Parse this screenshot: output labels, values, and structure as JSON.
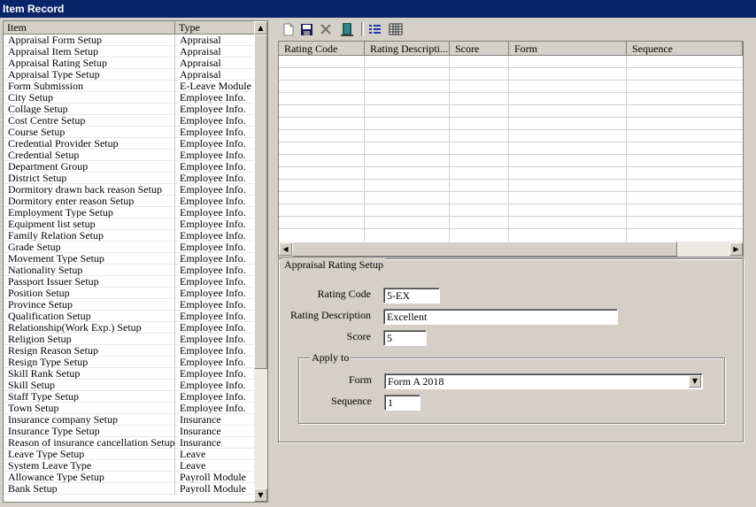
{
  "window": {
    "title": "Item Record"
  },
  "list": {
    "columns": [
      "Item",
      "Type"
    ],
    "rows": [
      [
        "Appraisal Form Setup",
        "Appraisal"
      ],
      [
        "Appraisal Item Setup",
        "Appraisal"
      ],
      [
        "Appraisal Rating Setup",
        "Appraisal"
      ],
      [
        "Appraisal Type Setup",
        "Appraisal"
      ],
      [
        "Form Submission",
        "E-Leave Module"
      ],
      [
        "City Setup",
        "Employee Info."
      ],
      [
        "Collage Setup",
        "Employee Info."
      ],
      [
        "Cost Centre Setup",
        "Employee Info."
      ],
      [
        "Course Setup",
        "Employee Info."
      ],
      [
        "Credential Provider Setup",
        "Employee Info."
      ],
      [
        "Credential Setup",
        "Employee Info."
      ],
      [
        "Department Group",
        "Employee Info."
      ],
      [
        "District Setup",
        "Employee Info."
      ],
      [
        "Dormitory drawn back reason Setup",
        "Employee Info."
      ],
      [
        "Dormitory enter reason Setup",
        "Employee Info."
      ],
      [
        "Employment Type Setup",
        "Employee Info."
      ],
      [
        "Equipment list setup",
        "Employee Info."
      ],
      [
        "Family Relation Setup",
        "Employee Info."
      ],
      [
        "Grade Setup",
        "Employee Info."
      ],
      [
        "Movement Type Setup",
        "Employee Info."
      ],
      [
        "Nationality Setup",
        "Employee Info."
      ],
      [
        "Passport Issuer Setup",
        "Employee Info."
      ],
      [
        "Position Setup",
        "Employee Info."
      ],
      [
        "Province Setup",
        "Employee Info."
      ],
      [
        "Qualification Setup",
        "Employee Info."
      ],
      [
        "Relationship(Work Exp.) Setup",
        "Employee Info."
      ],
      [
        "Religion Setup",
        "Employee Info."
      ],
      [
        "Resign Reason Setup",
        "Employee Info."
      ],
      [
        "Resign Type Setup",
        "Employee Info."
      ],
      [
        "Skill Rank Setup",
        "Employee Info."
      ],
      [
        "Skill Setup",
        "Employee Info."
      ],
      [
        "Staff Type Setup",
        "Employee Info."
      ],
      [
        "Town Setup",
        "Employee Info."
      ],
      [
        "Insurance company Setup",
        "Insurance"
      ],
      [
        "Insurance Type Setup",
        "Insurance"
      ],
      [
        "Reason of insurance cancellation Setup",
        "Insurance"
      ],
      [
        "Leave Type Setup",
        "Leave"
      ],
      [
        "System Leave Type",
        "Leave"
      ],
      [
        "Allowance Type Setup",
        "Payroll Module"
      ],
      [
        "Bank Setup",
        "Payroll Module"
      ]
    ]
  },
  "toolbar": {
    "icons": [
      "new-icon",
      "save-icon",
      "delete-icon",
      "exit-door-icon",
      "list-view-icon",
      "grid-view-icon"
    ]
  },
  "grid": {
    "columns": [
      "Rating Code",
      "Rating Descripti...",
      "Score",
      "Form",
      "Sequence"
    ]
  },
  "form": {
    "title": "Appraisal Rating Setup",
    "rating_code_label": "Rating Code",
    "rating_code_value": "5-EX",
    "rating_desc_label": "Rating Description",
    "rating_desc_value": "Excellent",
    "score_label": "Score",
    "score_value": "5",
    "apply_to": {
      "title": "Apply to",
      "form_label": "Form",
      "form_value": "Form A 2018",
      "sequence_label": "Sequence",
      "sequence_value": "1"
    }
  }
}
